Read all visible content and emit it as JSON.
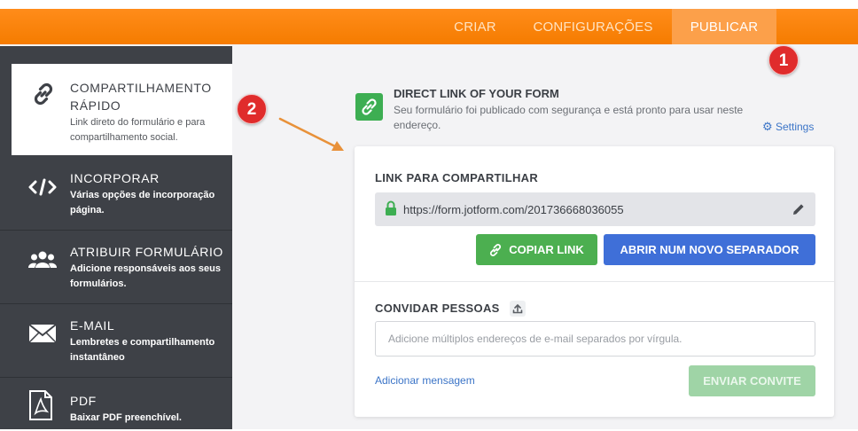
{
  "topbar": {
    "tabs": [
      {
        "label": "CRIAR"
      },
      {
        "label": "CONFIGURAÇÕES"
      },
      {
        "label": "PUBLICAR"
      }
    ],
    "active_tab": "PUBLICAR",
    "accent": "#f57c00"
  },
  "badges": {
    "first": "1",
    "second": "2"
  },
  "sidebar": {
    "items": [
      {
        "title": "COMPARTILHAMENTO RÁPIDO",
        "desc": "Link direto do formulário e para compartilhamento social.",
        "icon": "link-icon"
      },
      {
        "title": "INCORPORAR",
        "desc": "Várias opções de incorporação página.",
        "icon": "code-icon"
      },
      {
        "title": "ATRIBUIR FORMULÁRIO",
        "desc": "Adicione responsáveis aos seus formulários.",
        "icon": "users-icon"
      },
      {
        "title": "E-MAIL",
        "desc": "Lembretes e compartilhamento instantâneo",
        "icon": "envelope-icon"
      },
      {
        "title": "PDF",
        "desc": "Baixar PDF preenchível.",
        "icon": "pdf-icon"
      }
    ]
  },
  "direct_link": {
    "title": "DIRECT LINK OF YOUR FORM",
    "desc": "Seu formulário foi publicado com segurança e está pronto para usar neste endereço.",
    "settings_label": "Settings"
  },
  "share": {
    "label": "LINK PARA COMPARTILHAR",
    "url": "https://form.jotform.com/201736668036055",
    "copy_label": "COPIAR LINK",
    "open_label": "ABRIR NUM NOVO SEPARADOR"
  },
  "invite": {
    "label": "CONVIDAR PESSOAS",
    "placeholder": "Adicione múltiplos endereços de e-mail separados por vírgula.",
    "add_message": "Adicionar mensagem",
    "send_label": "ENVIAR CONVITE"
  },
  "colors": {
    "green": "#4caf50",
    "blue": "#3f6fd8",
    "disabled_green": "#9fd4a6",
    "sidebar": "#3e4147",
    "badge": "#e02c2c"
  }
}
